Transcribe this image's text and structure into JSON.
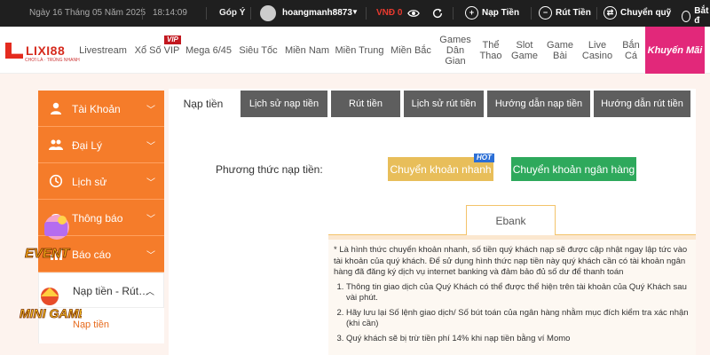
{
  "topbar": {
    "date": "Ngày 16 Tháng 05 Năm 2025",
    "time": "18:14:09",
    "feedback": "Góp Ý",
    "username": "hoangmanh8873",
    "balance": "VNĐ 0",
    "deposit": "Nạp Tiền",
    "withdraw": "Rút Tiền",
    "transfer": "Chuyển quỹ",
    "extra": "Bắt đ"
  },
  "brand": {
    "name": "LIXI88",
    "tagline": "CHƠI LÀ · TRÚNG NHANH"
  },
  "nav": {
    "items": [
      "Livestream",
      "Xổ Số VIP",
      "Mega 6/45",
      "Siêu Tốc",
      "Miền Nam",
      "Miền Trung",
      "Miền Bắc",
      "Games Dân Gian",
      "Thể Thao",
      "Slot Game",
      "Game Bài",
      "Live Casino",
      "Bắn Cá"
    ],
    "vip_badge": "VIP",
    "promo": "Khuyến Mãi"
  },
  "sidebar": {
    "items": [
      {
        "label": "Tài Khoản"
      },
      {
        "label": "Đại Lý"
      },
      {
        "label": "Lịch sử"
      },
      {
        "label": "Thông báo"
      },
      {
        "label": "Báo cáo"
      }
    ],
    "open_item": "Nạp tiền - Rút tiền",
    "sub_item": "Nạp tiền"
  },
  "art": {
    "event": "EVENT",
    "minigame": "MINI GAME"
  },
  "tabs": [
    "Nạp tiền",
    "Lịch sử nạp tiền",
    "Rút tiền",
    "Lịch sử rút tiền",
    "Hướng dẫn nạp tiền",
    "Hướng dẫn rút tiền"
  ],
  "deposit": {
    "method_label": "Phương thức nạp tiền:",
    "method_fast": "Chuyển khoản nhanh",
    "hot_badge": "HOT",
    "method_bank": "Chuyển khoản ngân hàng",
    "subtab": "Ebank",
    "note_lead": "* Là hình thức chuyển khoản nhanh, số tiền quý khách nạp sẽ được cập nhật ngay lập tức vào tài khoản của quý khách. Để sử dụng hình thức nạp tiền này quý khách cần có tài khoản ngân hàng đã đăng ký dịch vụ internet banking và đảm bảo đủ số dư để thanh toán",
    "notes": [
      "Thông tin giao dịch của Quý Khách có thể được thể hiện trên tài khoản của Quý Khách sau vài phút.",
      "Hãy lưu lại Số lệnh giao dịch/ Số bút toán của ngân hàng nhằm mục đích kiểm tra xác nhận (khi cần)",
      "Quý khách sẽ bị trừ tiền phí 14% khi nạp tiền bằng ví Momo"
    ]
  },
  "colors": {
    "orange": "#f57c2a",
    "green": "#2ea95c",
    "gold": "#e8be5a",
    "pink": "#e2287a",
    "tab_gray": "#5e5e5e",
    "balance_red": "#e93a2f"
  }
}
